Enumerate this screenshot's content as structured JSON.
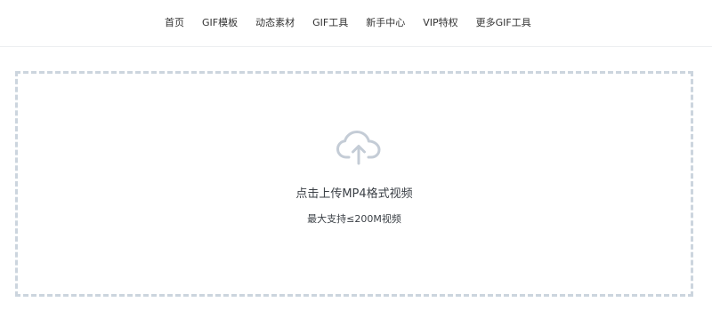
{
  "nav": {
    "items": [
      {
        "label": "首页"
      },
      {
        "label": "GIF模板"
      },
      {
        "label": "动态素材"
      },
      {
        "label": "GIF工具"
      },
      {
        "label": "新手中心"
      },
      {
        "label": "VIP特权"
      },
      {
        "label": "更多GIF工具"
      }
    ]
  },
  "upload": {
    "icon": "cloud-upload-icon",
    "title": "点击上传MP4格式视频",
    "limit": "最大支持≤200M视频",
    "border_color": "#ccd5de",
    "icon_color": "#c4ccd6"
  }
}
